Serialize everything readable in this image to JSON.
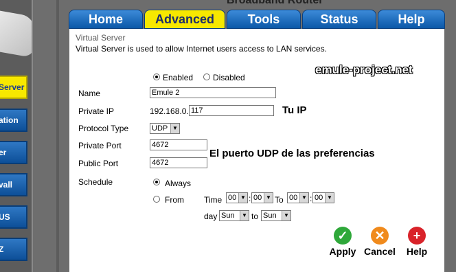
{
  "app": {
    "partial_title": "Broadband Router"
  },
  "tabs": [
    {
      "label": "Home"
    },
    {
      "label": "Advanced"
    },
    {
      "label": "Tools"
    },
    {
      "label": "Status"
    },
    {
      "label": "Help"
    }
  ],
  "sidebar": {
    "items": [
      {
        "label": "Server"
      },
      {
        "label": "ation"
      },
      {
        "label": "er"
      },
      {
        "label": "vall"
      },
      {
        "label": "US"
      },
      {
        "label": "Z"
      }
    ]
  },
  "section": {
    "title": "Virtual Server",
    "description": "Virtual Server is used to allow Internet users access to LAN services."
  },
  "form": {
    "enabled_label": "Enabled",
    "disabled_label": "Disabled",
    "name_label": "Name",
    "name_value": "Emule 2",
    "private_ip_label": "Private IP",
    "private_ip_prefix": "192.168.0.",
    "private_ip_value": "117",
    "protocol_label": "Protocol Type",
    "protocol_value": "UDP",
    "private_port_label": "Private Port",
    "private_port_value": "4672",
    "public_port_label": "Public Port",
    "public_port_value": "4672",
    "schedule_label": "Schedule",
    "always_label": "Always",
    "from_label": "From",
    "time_label": "Time",
    "to_label": "To",
    "time_from_hour": "00",
    "time_from_min": "00",
    "time_to_hour": "00",
    "time_to_min": "00",
    "day_label": "day",
    "day_from": "Sun",
    "day_to": "Sun",
    "day_to_label": "to",
    "colon": ":"
  },
  "annotations": {
    "tu_ip": "Tu IP",
    "udp_note": "El puerto UDP de las preferencias",
    "watermark": "emule-project.net"
  },
  "actions": {
    "apply": "Apply",
    "cancel": "Cancel",
    "help": "Help"
  },
  "colors": {
    "tab_active": "#f7e800",
    "tab_blue": "#0b58a8",
    "apply_green": "#2fa83a",
    "cancel_orange": "#f08a1c",
    "help_red": "#d9232a"
  }
}
